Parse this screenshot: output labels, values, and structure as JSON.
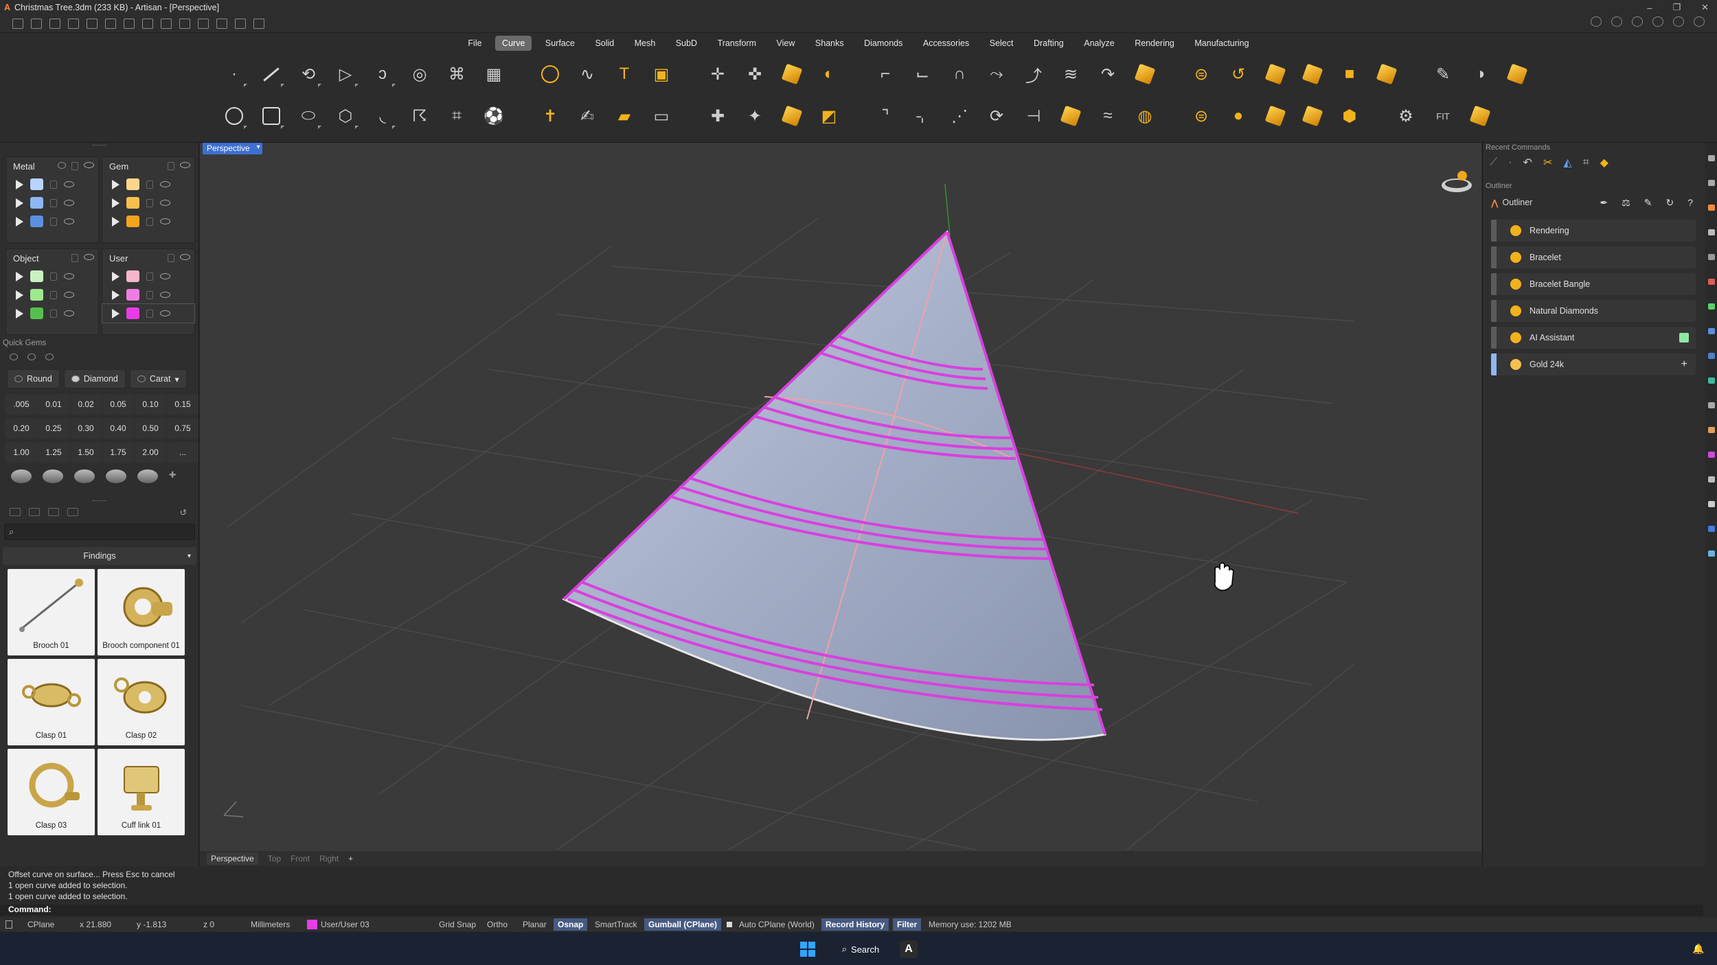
{
  "window": {
    "title": "Christmas Tree.3dm (233 KB) - Artisan - [Perspective]",
    "app_logo_char": "A"
  },
  "menu": [
    {
      "label": "File",
      "active": false
    },
    {
      "label": "Curve",
      "active": true
    },
    {
      "label": "Surface",
      "active": false
    },
    {
      "label": "Solid",
      "active": false
    },
    {
      "label": "Mesh",
      "active": false
    },
    {
      "label": "SubD",
      "active": false
    },
    {
      "label": "Transform",
      "active": false
    },
    {
      "label": "View",
      "active": false
    },
    {
      "label": "Shanks",
      "active": false
    },
    {
      "label": "Diamonds",
      "active": false
    },
    {
      "label": "Accessories",
      "active": false
    },
    {
      "label": "Select",
      "active": false
    },
    {
      "label": "Drafting",
      "active": false
    },
    {
      "label": "Analyze",
      "active": false
    },
    {
      "label": "Rendering",
      "active": false
    },
    {
      "label": "Manufacturing",
      "active": false
    }
  ],
  "layers": {
    "metal": {
      "label": "Metal",
      "colors": [
        "#b8d4ff",
        "#8db6f2",
        "#5b8fe0"
      ]
    },
    "gem": {
      "label": "Gem",
      "colors": [
        "#fcd68c",
        "#f7c04e",
        "#f2a41c"
      ]
    },
    "object": {
      "label": "Object",
      "colors": [
        "#c8f2c0",
        "#9ee890",
        "#56c04e"
      ]
    },
    "user": {
      "label": "User",
      "colors": [
        "#f7b6cc",
        "#ee7ee2",
        "#e83ce6"
      ]
    }
  },
  "quick_gems": {
    "title": "Quick Gems",
    "shapes": [
      "Round",
      "Diamond",
      "Carat"
    ],
    "sizes": [
      ".005",
      "0.01",
      "0.02",
      "0.05",
      "0.10",
      "0.15",
      "0.20",
      "0.25",
      "0.30",
      "0.40",
      "0.50",
      "0.75",
      "1.00",
      "1.25",
      "1.50",
      "1.75",
      "2.00",
      "..."
    ]
  },
  "library": {
    "category": "Findings",
    "items": [
      "Brooch 01",
      "Brooch component 01",
      "Clasp 01",
      "Clasp 02",
      "Clasp 03",
      "Cuff link 01"
    ]
  },
  "viewport": {
    "active_tab": "Perspective",
    "tabs": [
      "Perspective",
      "Top",
      "Front",
      "Right"
    ],
    "add_tab": "+"
  },
  "right": {
    "recent_title": "Recent Commands",
    "outliner_title": "Outliner",
    "outliner_label": "Outliner",
    "items": [
      {
        "label": "Rendering",
        "bar": "#5c5c5c",
        "icon_color": "#f2b21c"
      },
      {
        "label": "Bracelet",
        "bar": "#5c5c5c",
        "icon_color": "#f2b21c"
      },
      {
        "label": "Bracelet Bangle",
        "bar": "#5c5c5c",
        "icon_color": "#f2b21c"
      },
      {
        "label": "Natural Diamonds",
        "bar": "#5c5c5c",
        "icon_color": "#f2b21c"
      },
      {
        "label": "AI Assistant",
        "bar": "#5c5c5c",
        "icon_color": "#f2b21c",
        "trail": "green-square"
      },
      {
        "label": "Gold 24k",
        "bar": "#8fb8f0",
        "icon_color": "#f7c04e",
        "trail": "+"
      }
    ]
  },
  "command": {
    "history": [
      "Offset curve on surface... Press Esc to cancel",
      "1 open curve added to selection.",
      "1 open curve added to selection."
    ],
    "prompt": "Command:"
  },
  "status": {
    "cplane": "CPlane",
    "x": "x 21.880",
    "y": "y -1.813",
    "z": "z 0",
    "units": "Millimeters",
    "layer": "User/User 03",
    "layer_color": "#e83ce6",
    "grid_snap": "Grid Snap",
    "ortho": "Ortho",
    "planar": "Planar",
    "osnap": "Osnap",
    "smarttrack": "SmartTrack",
    "gumball": "Gumball (CPlane)",
    "auto_cplane": "Auto CPlane (World)",
    "record_history": "Record History",
    "filter": "Filter",
    "memory": "Memory use: 1202 MB"
  },
  "taskbar": {
    "search": "Search"
  },
  "colors": {
    "accent": "#3e6fd1",
    "curve": "#d940e0",
    "surface": "#a6b0c8"
  }
}
